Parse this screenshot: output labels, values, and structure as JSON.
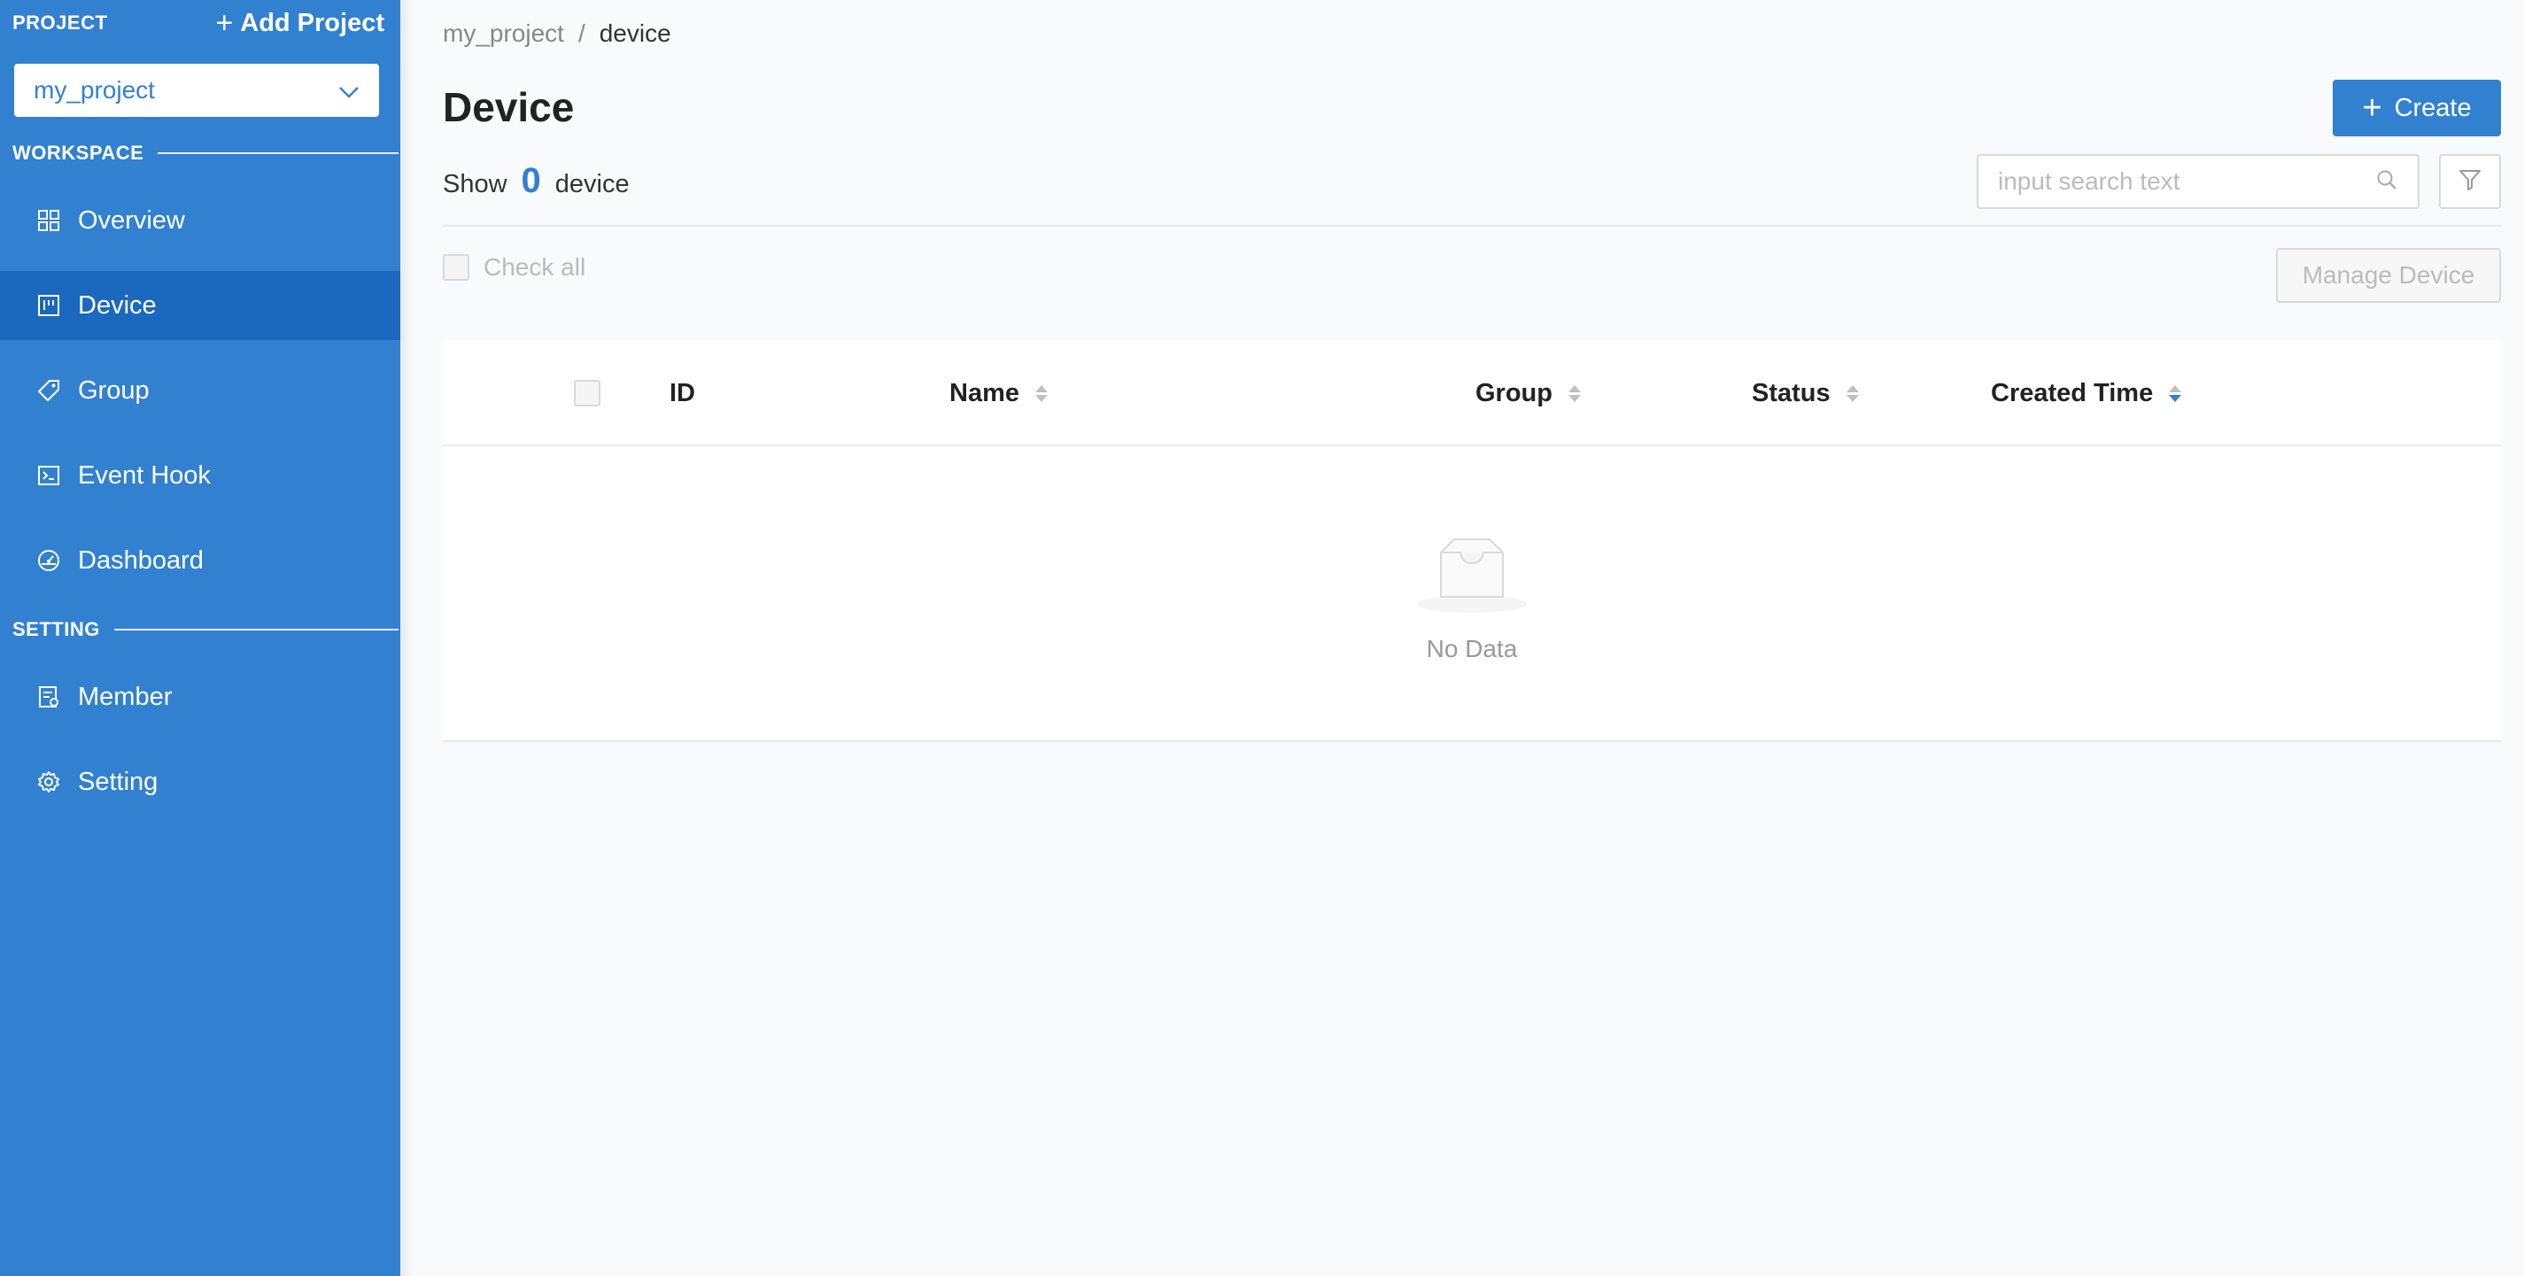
{
  "sidebar": {
    "project_label": "PROJECT",
    "add_project": "Add Project",
    "selected_project": "my_project",
    "workspace_label": "WORKSPACE",
    "setting_label": "SETTING",
    "workspace_items": [
      {
        "label": "Overview",
        "icon": "grid-icon"
      },
      {
        "label": "Device",
        "icon": "device-icon",
        "active": true
      },
      {
        "label": "Group",
        "icon": "tag-icon"
      },
      {
        "label": "Event Hook",
        "icon": "terminal-icon"
      },
      {
        "label": "Dashboard",
        "icon": "gauge-icon"
      }
    ],
    "setting_items": [
      {
        "label": "Member",
        "icon": "member-icon"
      },
      {
        "label": "Setting",
        "icon": "gear-icon"
      }
    ]
  },
  "breadcrumb": {
    "project": "my_project",
    "separator": "/",
    "current": "device"
  },
  "page": {
    "title": "Device",
    "create_label": "Create",
    "show_label": "Show",
    "count": "0",
    "count_unit": "device",
    "search_placeholder": "input search text",
    "check_all": "Check all",
    "manage_label": "Manage Device"
  },
  "table": {
    "columns": [
      "ID",
      "Name",
      "Group",
      "Status",
      "Created Time"
    ],
    "empty_text": "No Data"
  },
  "colors": {
    "accent": "#3281d0",
    "active_nav": "#1b68bf"
  }
}
